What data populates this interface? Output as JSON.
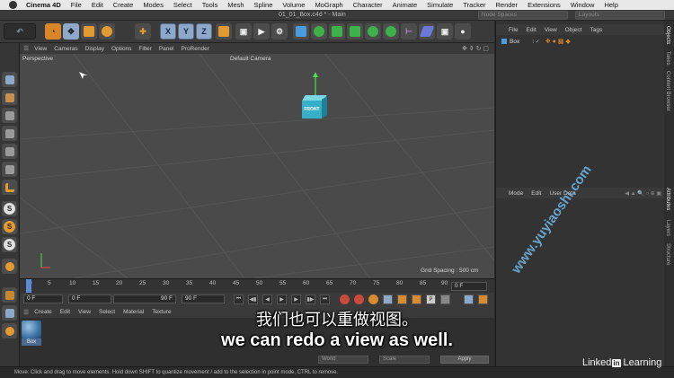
{
  "menubar": {
    "app": "Cinema 4D",
    "items": [
      "File",
      "Edit",
      "Create",
      "Modes",
      "Select",
      "Tools",
      "Mesh",
      "Spline",
      "Volume",
      "MoGraph",
      "Character",
      "Animate",
      "Simulate",
      "Tracker",
      "Render",
      "Extensions",
      "Window",
      "Help"
    ]
  },
  "window": {
    "document_title": "01_01_Box.c4d * - Main",
    "node_spaces": "Node Spaces",
    "layouts": "Layouts"
  },
  "toolbar": {
    "axis_buttons": [
      "X",
      "Y",
      "Z"
    ]
  },
  "viewport": {
    "menu": [
      "View",
      "Cameras",
      "Display",
      "Options",
      "Filter",
      "Panel",
      "ProRender"
    ],
    "view_name": "Perspective",
    "camera": "Default Camera",
    "grid_spacing": "Grid Spacing : 500 cm",
    "cube_label": "FRONT",
    "colors": {
      "background": "#4a4a4a",
      "cube": "#35b0c8",
      "y_axis": "#4fdc4f"
    }
  },
  "timeline": {
    "ticks": [
      "0",
      "5",
      "10",
      "15",
      "20",
      "25",
      "30",
      "35",
      "40",
      "45",
      "50",
      "55",
      "60",
      "65",
      "70",
      "75",
      "80",
      "85",
      "90"
    ],
    "current_frame": "0 F",
    "start_field": "0 F",
    "range_start": "0 F",
    "range_end": "90 F",
    "end_field": "90 F"
  },
  "materials": {
    "menu": [
      "Create",
      "Edit",
      "View",
      "Select",
      "Material",
      "Texture"
    ],
    "items": [
      {
        "name": "Box"
      }
    ]
  },
  "coordinates": {
    "space_select": "World",
    "mode_select": "Scale",
    "apply_label": "Apply"
  },
  "objects_panel": {
    "menu": [
      "File",
      "Edit",
      "View",
      "Object",
      "Tags"
    ],
    "objects": [
      {
        "name": "Box"
      }
    ]
  },
  "attributes_panel": {
    "menu": [
      "Mode",
      "Edit",
      "User Data"
    ]
  },
  "side_tabs": [
    "Objects",
    "Takes",
    "Content Browser",
    "Attributes",
    "Layers",
    "Structure"
  ],
  "status": "Move: Click and drag to move elements. Hold down SHIFT to quantize movement / add to the selection in point mode, CTRL to remove.",
  "subtitles": {
    "chinese": "我们也可以重做视图。",
    "english": "we can redo a view as well."
  },
  "watermark": "www.yuyiaoshi.com",
  "brand": {
    "left": "Linked",
    "box": "in",
    "right": "Learning"
  }
}
